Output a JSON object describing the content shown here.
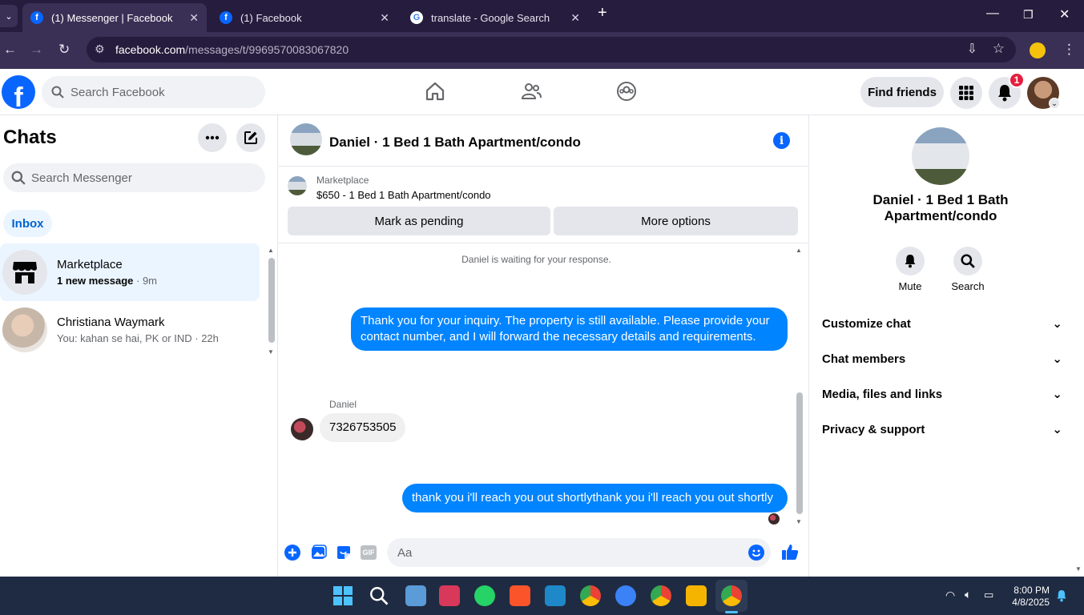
{
  "browser": {
    "tabs": [
      {
        "title": "(1) Messenger | Facebook",
        "active": true
      },
      {
        "title": "(1) Facebook",
        "active": false
      },
      {
        "title": "translate - Google Search",
        "active": false
      }
    ],
    "url_host": "facebook.com",
    "url_path": "/messages/t/9969570083067820"
  },
  "header": {
    "search_placeholder": "Search Facebook",
    "find_friends": "Find friends",
    "notification_count": "1"
  },
  "sidebar": {
    "title": "Chats",
    "search_placeholder": "Search Messenger",
    "filter": "Inbox",
    "chats": [
      {
        "name": "Marketplace",
        "preview_bold": "1 new message",
        "time": "· 9m"
      },
      {
        "name": "Christiana Waymark",
        "preview": "You: kahan se hai, PK or IND",
        "time": "· 22h"
      }
    ]
  },
  "conversation": {
    "title": "Daniel · 1 Bed 1 Bath Apartment/condo",
    "marketplace_label": "Marketplace",
    "listing": "$650 - 1 Bed 1 Bath Apartment/condo",
    "btn_pending": "Mark as pending",
    "btn_more": "More options",
    "waiting_notice": "Daniel is waiting for your response.",
    "messages": [
      {
        "from": "me",
        "text": "Thank you for your inquiry. The property is still available. Please provide your contact number, and I will forward the necessary details and requirements."
      },
      {
        "from": "Daniel",
        "text": "7326753505"
      },
      {
        "from": "me",
        "text": "thank you i'll reach you out shortlythank you i'll reach you out shortly"
      }
    ],
    "composer_placeholder": "Aa"
  },
  "details": {
    "title": "Daniel · 1 Bed 1 Bath Apartment/condo",
    "actions": [
      "Mute",
      "Search"
    ],
    "sections": [
      "Customize chat",
      "Chat members",
      "Media, files and links",
      "Privacy & support"
    ]
  },
  "taskbar": {
    "time": "8:00 PM",
    "date": "4/8/2025"
  },
  "colors": {
    "brand": "#0866ff",
    "bubble_out": "#0084ff",
    "bubble_in": "#f0f0f0",
    "selected_chat": "#ebf5ff"
  }
}
